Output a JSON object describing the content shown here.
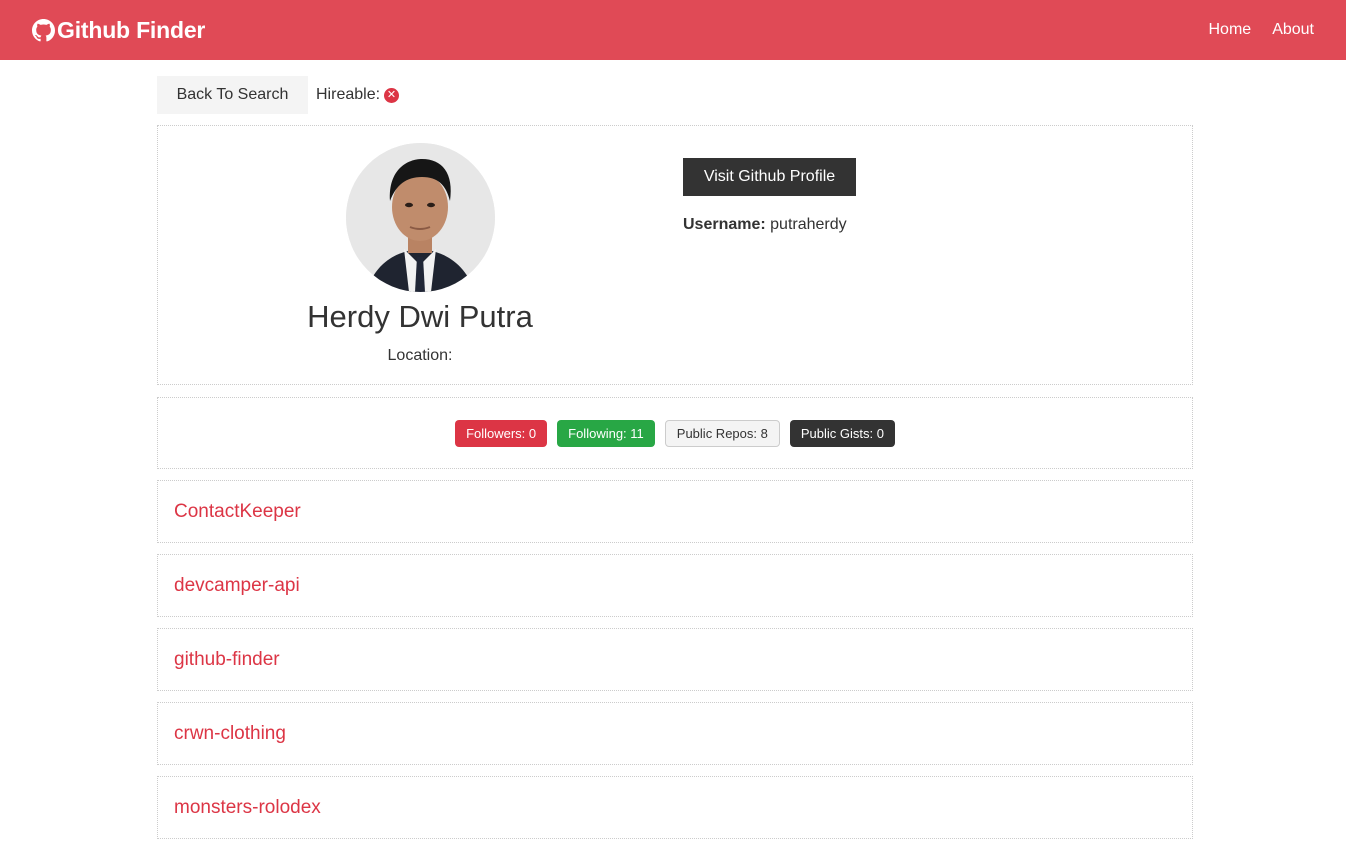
{
  "navbar": {
    "brand": "Github Finder",
    "links": [
      "Home",
      "About"
    ]
  },
  "topbar": {
    "back_label": "Back To Search",
    "hireable_label": "Hireable:",
    "hireable_icon": "times-circle-icon"
  },
  "profile": {
    "name": "Herdy Dwi Putra",
    "location_label": "Location:",
    "visit_label": "Visit Github Profile",
    "username_label": "Username:",
    "username": "putraherdy"
  },
  "stats": {
    "followers": "Followers: 0",
    "following": "Following: 11",
    "repos": "Public Repos: 8",
    "gists": "Public Gists: 0"
  },
  "repos": [
    "ContactKeeper",
    "devcamper-api",
    "github-finder",
    "crwn-clothing",
    "monsters-rolodex"
  ],
  "colors": {
    "primary": "#dc3545",
    "navbar": "#e04a56",
    "success": "#28a745",
    "dark": "#333333",
    "light": "#f4f4f4"
  }
}
